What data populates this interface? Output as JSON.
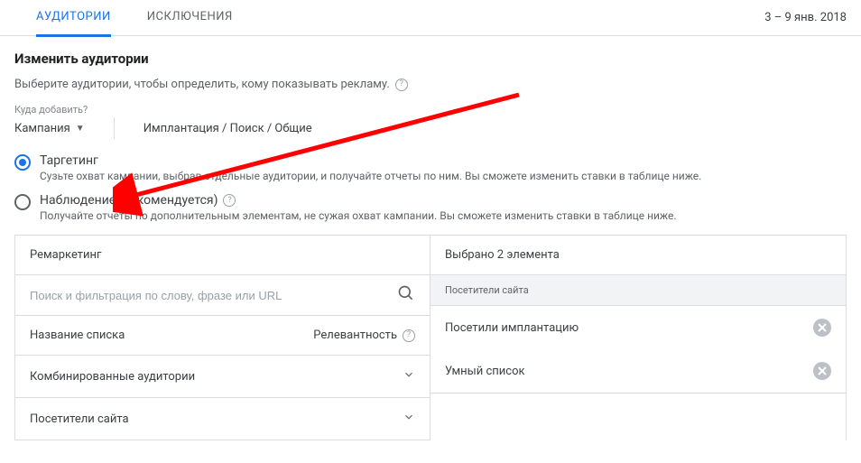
{
  "tabs": {
    "audiences": "АУДИТОРИИ",
    "exclusions": "ИСКЛЮЧЕНИЯ"
  },
  "daterange": "3 – 9 янв. 2018",
  "header": {
    "title": "Изменить аудитории",
    "subtitle": "Выберите аудитории, чтобы определить, кому показывать рекламу."
  },
  "where": {
    "label": "Куда добавить?",
    "level": "Кампания",
    "path": "Имплантация / Поиск / Общие"
  },
  "options": {
    "targeting": {
      "title": "Таргетинг",
      "desc": "Сузьте охват кампании, выбрав отдельные аудитории, и получайте отчеты по ним. Вы сможете изменить ставки в таблице ниже."
    },
    "observation": {
      "title": "Наблюдение (рекомендуется)",
      "desc": "Получайте отчеты по дополнительным элементам, не сужая охват кампании. Вы сможете изменить ставки в таблице ниже."
    }
  },
  "left": {
    "header": "Ремаркетинг",
    "search_placeholder": "Поиск и фильтрация по слову, фразе или URL",
    "col_name": "Название списка",
    "col_relevance": "Релевантность",
    "rows": {
      "combined": "Комбинированные аудитории",
      "visitors": "Посетители сайта"
    }
  },
  "right": {
    "header": "Выбрано 2 элемента",
    "section": "Посетители сайта",
    "items": {
      "0": "Посетили имплантацию",
      "1": "Умный список"
    }
  }
}
